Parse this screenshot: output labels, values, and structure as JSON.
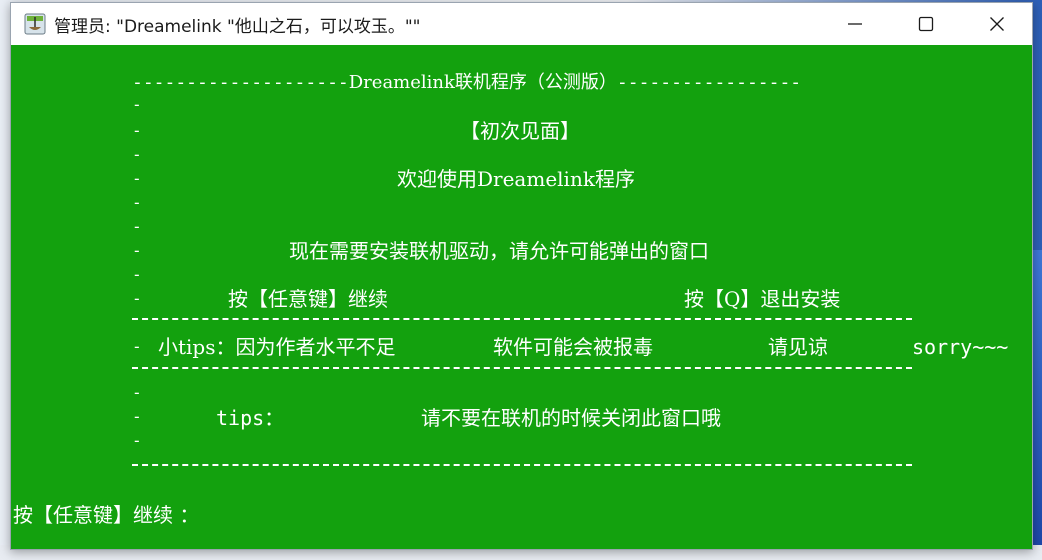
{
  "window": {
    "title": "管理员:  \"Dreamelink \"他山之石，可以攻玉。\"\""
  },
  "console": {
    "header_dashes_left": "--------------------",
    "header_title": "Dreamelink联机程序（公测版）",
    "header_dashes_right": "-----------------",
    "first_meeting": "【初次见面】",
    "welcome": "欢迎使用Dreamelink程序",
    "install_notice": "现在需要安装联机驱动，请允许可能弹出的窗口",
    "press_any_key": "按【任意键】继续",
    "press_q": "按【Q】退出安装",
    "tips_prefix": "小tips：因为作者水平不足",
    "tips_mid": "软件可能会被报毒",
    "tips_forgive": "请见谅",
    "tips_sorry": "sorry~~~",
    "tips_label": "tips：",
    "tips_warning": "请不要在联机的时候关闭此窗口哦",
    "prompt": "按【任意键】继续 ："
  },
  "icons": {
    "app": "console-app-icon",
    "minimize": "minimize-icon",
    "maximize": "maximize-icon",
    "close": "close-icon"
  },
  "colors": {
    "console_bg": "#13a10e",
    "console_fg": "#ffffff",
    "titlebar_bg": "#ffffff"
  }
}
